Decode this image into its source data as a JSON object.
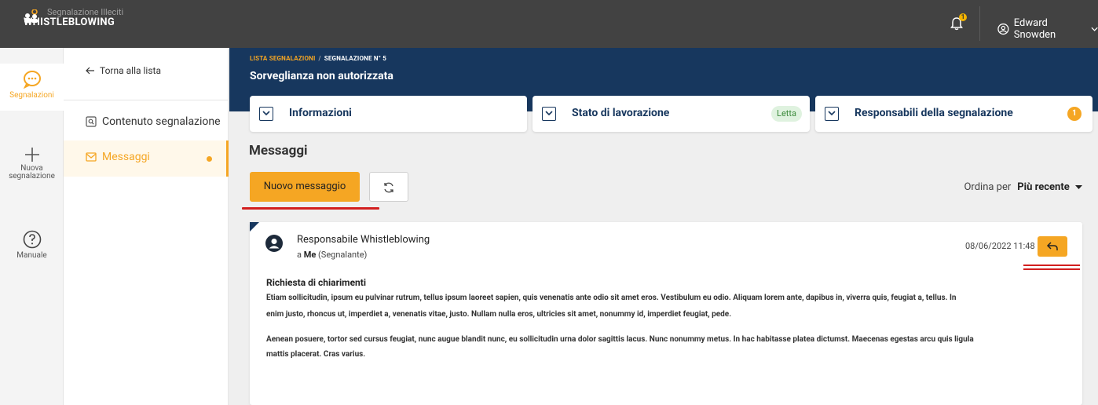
{
  "topbar": {
    "logo_sub": "Segnalazione Illeciti",
    "logo_main": "WHISTLEBLOWING",
    "notification_count": "1",
    "user_name": "Edward Snowden"
  },
  "rail": {
    "items": [
      {
        "label": "Segnalazioni",
        "icon": "chat-bubble-icon"
      },
      {
        "label": "Nuova segnalazione",
        "icon": "plus-icon"
      },
      {
        "label": "Manuale",
        "icon": "help-circle-icon"
      }
    ]
  },
  "subnav": {
    "back_label": "Torna alla lista",
    "items": [
      {
        "label": "Contenuto segnalazione",
        "icon": "document-search-icon"
      },
      {
        "label": "Messaggi",
        "icon": "envelope-icon"
      }
    ]
  },
  "header": {
    "breadcrumb": [
      "LISTA SEGNALAZIONI",
      "SEGNALAZIONE N° 5"
    ],
    "title": "Sorveglianza non autorizzata"
  },
  "cards": [
    {
      "label": "Informazioni"
    },
    {
      "label": "Stato di lavorazione",
      "status": "Letta"
    },
    {
      "label": "Responsabili della segnalazione",
      "count": "1"
    }
  ],
  "messages_section": {
    "title": "Messaggi",
    "new_button": "Nuovo messaggio",
    "sort_label": "Ordina per",
    "sort_value": "Più recente"
  },
  "message": {
    "sender": "Responsabile Whistleblowing",
    "to_prefix": "a",
    "to_name": "Me",
    "to_role": "(Segnalante)",
    "date": "08/06/2022 11:48",
    "subject": "Richiesta di chiarimenti",
    "paragraph1_line1": "Etiam sollicitudin, ipsum eu pulvinar rutrum, tellus ipsum laoreet sapien, quis venenatis ante odio sit amet eros. Vestibulum eu odio. Aliquam lorem ante, dapibus in, viverra quis, feugiat a, tellus. In",
    "paragraph1_line2": "enim justo, rhoncus ut, imperdiet a, venenatis vitae, justo. Nullam nulla eros, ultricies sit amet, nonummy id, imperdiet feugiat, pede.",
    "paragraph2_line1": "Aenean posuere, tortor sed cursus feugiat, nunc augue blandit nunc, eu sollicitudin urna dolor sagittis lacus. Nunc nonummy metus. In hac habitasse platea dictumst. Maecenas egestas arcu quis ligula",
    "paragraph2_line2": "mattis placerat. Cras varius."
  },
  "colors": {
    "accent": "#f5a623",
    "navy": "#17375e",
    "topbar": "#424242",
    "annotation_red": "#d21f1f"
  }
}
